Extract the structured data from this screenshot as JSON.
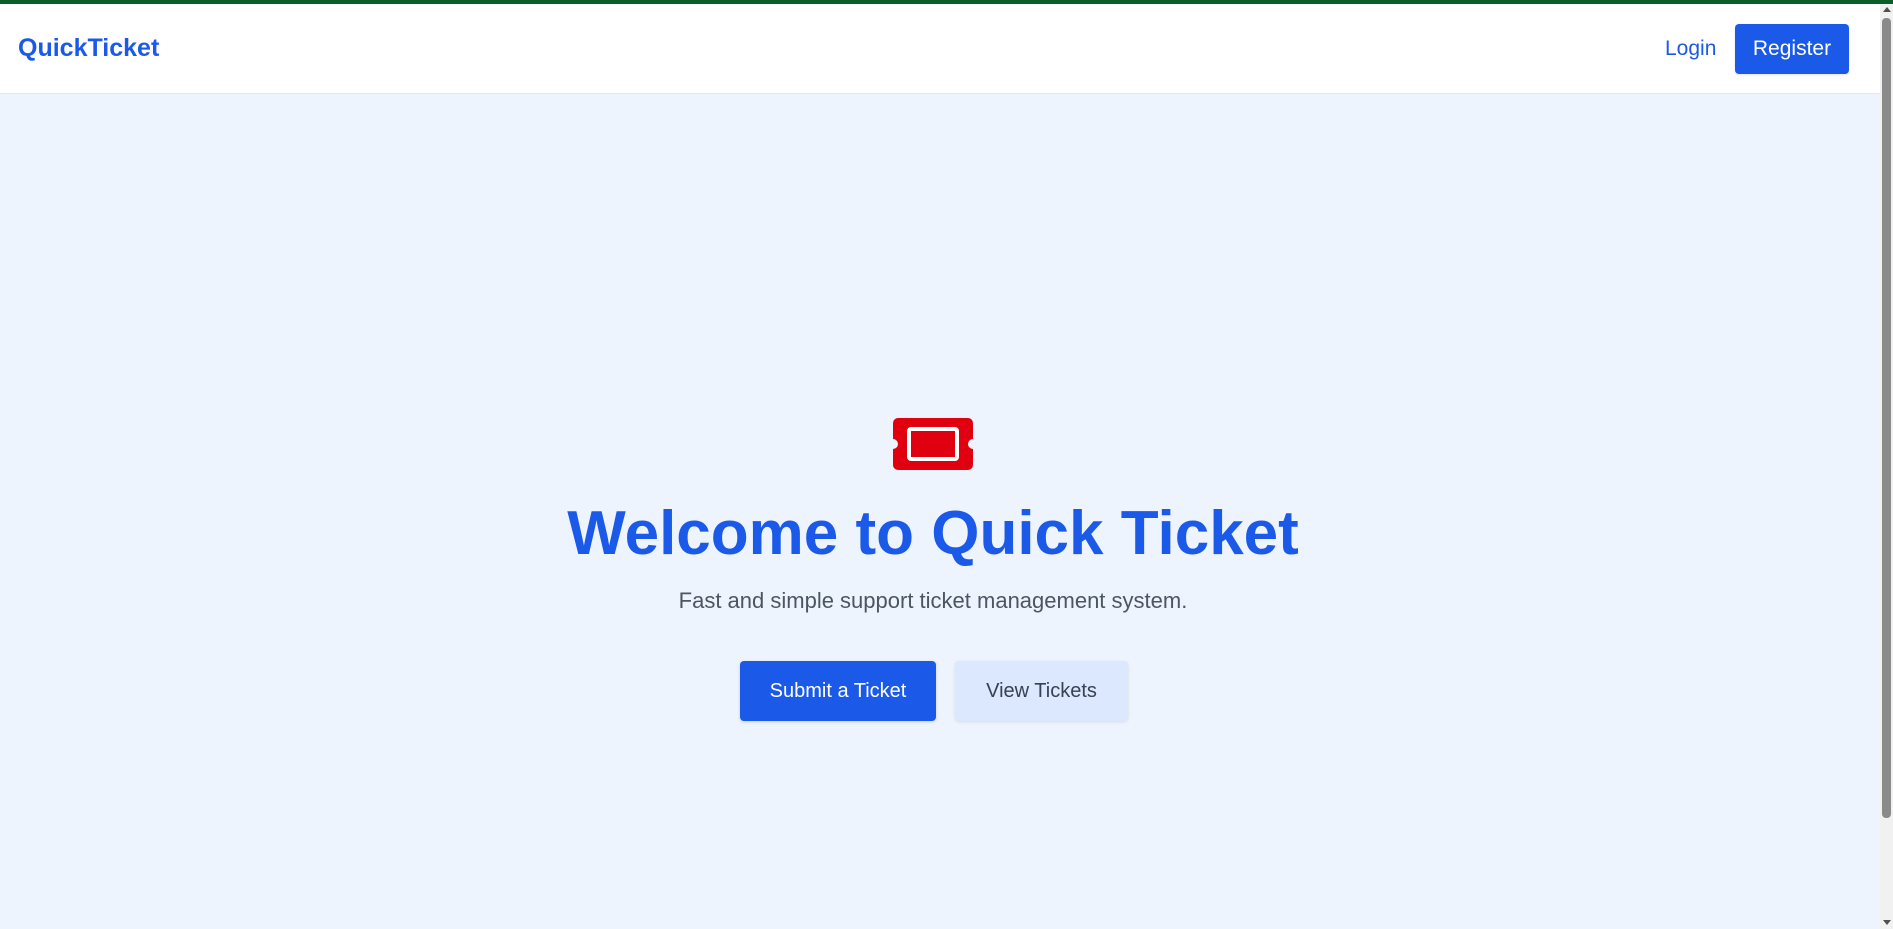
{
  "navbar": {
    "brand": "QuickTicket",
    "login_label": "Login",
    "register_label": "Register"
  },
  "hero": {
    "icon": "ticket-icon",
    "title": "Welcome to Quick Ticket",
    "subtitle": "Fast and simple support ticket management system.",
    "primary_button": "Submit a Ticket",
    "secondary_button": "View Tickets"
  },
  "colors": {
    "accent": "#1b5ae8",
    "icon": "#e0000f",
    "background": "#eef4fe",
    "secondary_button_bg": "#dbe8fd"
  }
}
